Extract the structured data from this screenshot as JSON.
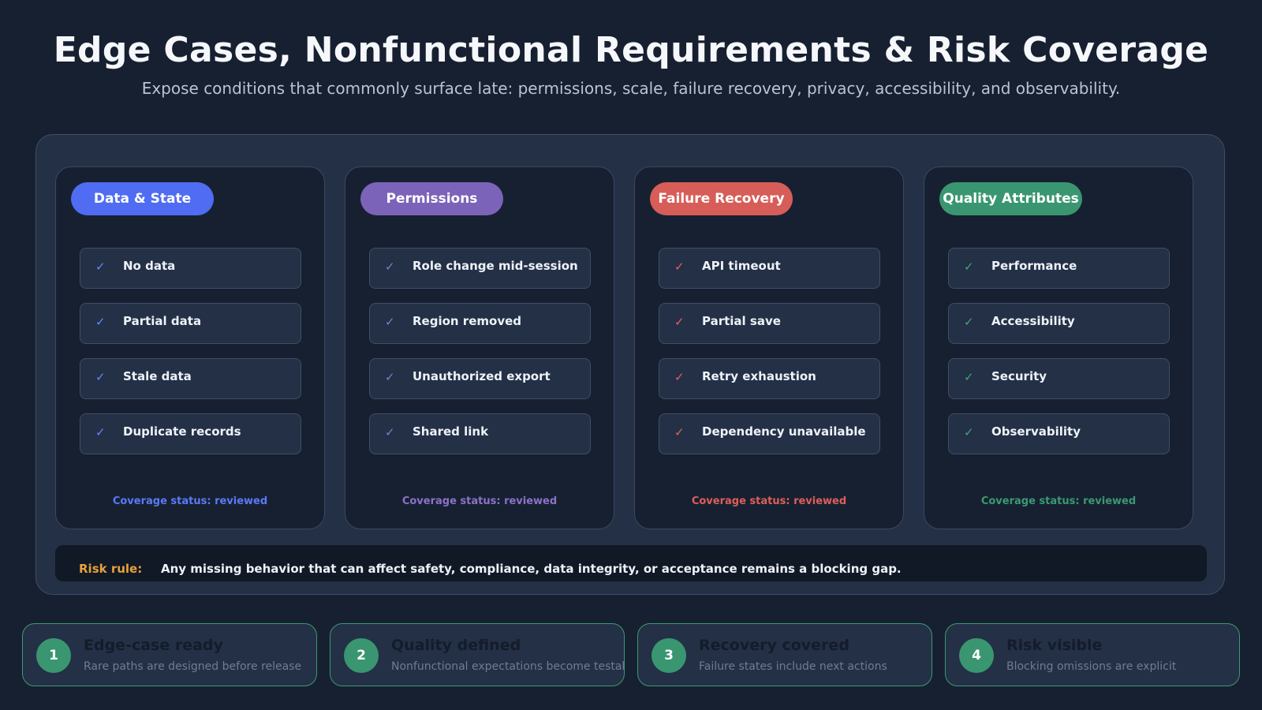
{
  "header": {
    "title": "Edge Cases, Nonfunctional Requirements & Risk Coverage",
    "subtitle": "Expose conditions that commonly surface late: permissions, scale, failure recovery, privacy, accessibility, and observability."
  },
  "columns": [
    {
      "title": "Data & State",
      "color": "#4f6cf3",
      "check_color": "#6a86ff",
      "items": [
        "No data",
        "Partial data",
        "Stale data",
        "Duplicate records"
      ],
      "coverage": "Coverage status: reviewed"
    },
    {
      "title": "Permissions",
      "color": "#7b63b9",
      "check_color": "#8d76cc",
      "items": [
        "Role change mid-session",
        "Region removed",
        "Unauthorized export",
        "Shared link"
      ],
      "coverage": "Coverage status: reviewed"
    },
    {
      "title": "Failure Recovery",
      "color": "#d75d58",
      "check_color": "#e0625c",
      "items": [
        "API timeout",
        "Partial save",
        "Retry exhaustion",
        "Dependency unavailable"
      ],
      "coverage": "Coverage status: reviewed"
    },
    {
      "title": "Quality Attributes",
      "color": "#3a9670",
      "check_color": "#3fa57a",
      "items": [
        "Performance",
        "Accessibility",
        "Security",
        "Observability"
      ],
      "coverage": "Coverage status: reviewed"
    }
  ],
  "check_glyph": "✓",
  "risk": {
    "label": "Risk rule:",
    "text": "Any missing behavior that can affect safety, compliance, data integrity, or acceptance remains a blocking gap."
  },
  "steps": [
    {
      "num": "1",
      "title": "Edge-case ready",
      "desc": "Rare paths are designed before release"
    },
    {
      "num": "2",
      "title": "Quality defined",
      "desc": "Nonfunctional expectations become testable"
    },
    {
      "num": "3",
      "title": "Recovery covered",
      "desc": "Failure states include next actions"
    },
    {
      "num": "4",
      "title": "Risk visible",
      "desc": "Blocking omissions are explicit"
    }
  ]
}
